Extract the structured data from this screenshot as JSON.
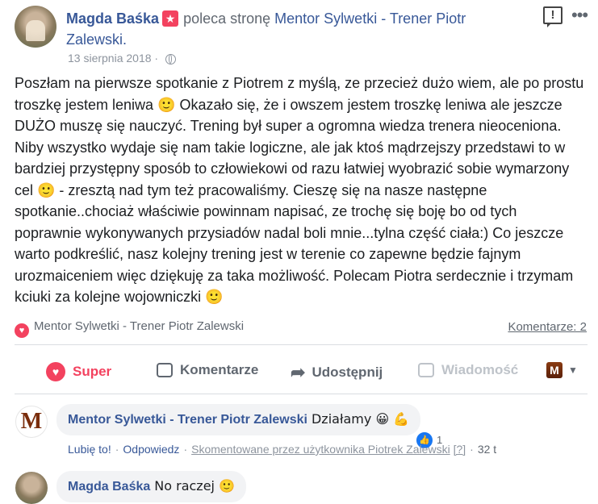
{
  "post": {
    "author": "Magda Baśka",
    "recommends_text": "poleca stronę",
    "page_name": "Mentor Sylwetki - Trener Piotr Zalewski.",
    "date": "13 sierpnia 2018",
    "date_separator": "·",
    "body": "Poszłam na pierwsze spotkanie z Piotrem z myślą, ze przecież dużo wiem, ale po prostu troszkę jestem leniwa 🙂 Okazało się, że i owszem jestem troszkę leniwa ale jeszcze DUŻO muszę się nauczyć. Trening był super a ogromna wiedza trenera nieoceniona. Niby wszystko wydaje się nam takie logiczne, ale jak ktoś mądrzejszy przedstawi to w bardziej przystępny sposób to człowiekowi od razu łatwiej wyobrazić sobie wymarzony cel 🙂 - zresztą nad tym też pracowaliśmy. Cieszę się na nasze następne spotkanie..chociaż właściwie powinnam napisać, ze trochę się boję bo od tych poprawnie wykonywanych przysiadów nadal boli mnie...tylna część ciała:) Co jeszcze warto podkreślić, nasz kolejny trening jest w terenie co zapewne będzie fajnym urozmaiceniem więc dziękuję za taka możliwość. Polecam Piotra serdecznie i trzymam kciuki za kolejne wojowniczki 🙂",
    "tagged_page": "Mentor Sylwetki - Trener Piotr Zalewski",
    "comments_count_label": "Komentarze: 2"
  },
  "actions": {
    "super": "Super",
    "comment": "Komentarze",
    "share": "Udostępnij",
    "message": "Wiadomość"
  },
  "comments": [
    {
      "author": "Mentor Sylwetki - Trener Piotr Zalewski",
      "text": "Działamy 😀 💪",
      "like": "Lubię to!",
      "reply": "Odpowiedz",
      "edited_by": "Skomentowane przez użytkownika Piotrek Zalewski",
      "help": "[?]",
      "age": "32 t",
      "reactions": "1"
    },
    {
      "author": "Magda Baśka",
      "text": "No raczej 🙂"
    }
  ],
  "icons": {
    "badge": "star-badge-icon",
    "report": "report-icon",
    "more": "more-icon",
    "globe": "globe-icon",
    "heart": "heart-icon",
    "comment": "comment-bubble-icon",
    "share": "share-arrow-icon",
    "message": "message-icon",
    "like": "thumbs-up-icon"
  },
  "colors": {
    "link": "#385898",
    "super": "#f3425f",
    "like": "#1877f2",
    "muted": "#606770"
  }
}
